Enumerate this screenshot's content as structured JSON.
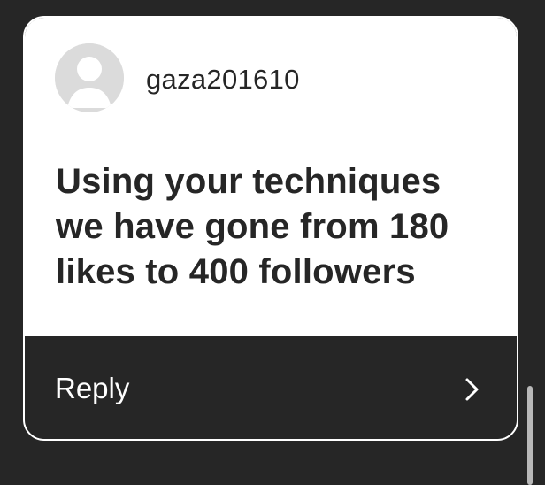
{
  "comment": {
    "username": "gaza201610",
    "text": "Using your techniques we have gone from 180 likes to 400 followers",
    "avatar_icon": "default-profile-avatar-icon"
  },
  "reply": {
    "label": "Reply",
    "icon": "chevron-right-icon"
  },
  "colors": {
    "background": "#262626",
    "card_top": "#ffffff",
    "avatar": "#dbdbdb",
    "text": "#262626",
    "reply_text": "#ffffff"
  }
}
